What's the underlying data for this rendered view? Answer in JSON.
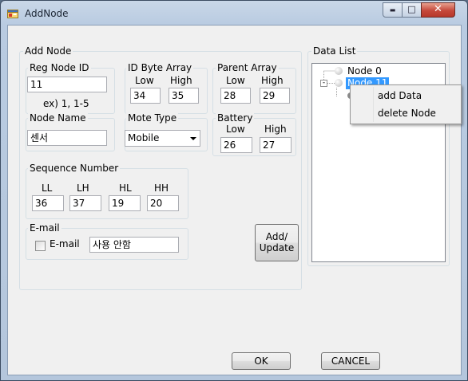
{
  "window": {
    "title": "AddNode"
  },
  "caption_buttons": {
    "minimize": "▬",
    "maximize": "□",
    "close": "✕"
  },
  "add_node": {
    "label": "Add Node",
    "reg_node_id": {
      "label": "Reg Node ID",
      "value": "11",
      "hint": "ex) 1, 1-5"
    },
    "id_byte_array": {
      "label": "ID Byte Array",
      "low_label": "Low",
      "high_label": "High",
      "low": "34",
      "high": "35"
    },
    "parent_array": {
      "label": "Parent Array",
      "low_label": "Low",
      "high_label": "High",
      "low": "28",
      "high": "29"
    },
    "node_name": {
      "label": "Node Name",
      "value": "센서"
    },
    "mote_type": {
      "label": "Mote Type",
      "value": "Mobile"
    },
    "battery": {
      "label": "Battery",
      "low_label": "Low",
      "high_label": "High",
      "low": "26",
      "high": "27"
    },
    "sequence": {
      "label": "Sequence Number",
      "ll_label": "LL",
      "lh_label": "LH",
      "hl_label": "HL",
      "hh_label": "HH",
      "ll": "36",
      "lh": "37",
      "hl": "19",
      "hh": "20"
    },
    "email": {
      "label": "E-mail",
      "checkbox_label": "E-mail",
      "value": "사용 안함",
      "checked": false
    },
    "add_update": {
      "line1": "Add/",
      "line2": "Update"
    }
  },
  "data_list": {
    "label": "Data List",
    "nodes": [
      "Node 0",
      "Node 11"
    ],
    "selected_index": 1
  },
  "context_menu": {
    "items": [
      "add Data",
      "delete Node"
    ]
  },
  "footer": {
    "ok": "OK",
    "cancel": "CANCEL"
  },
  "colors": {
    "selection": "#3399ff",
    "group_border": "#d5dfe5",
    "title_gradient_top": "#c9d7e8"
  },
  "icons": [
    "app-form-icon",
    "minimize-icon",
    "maximize-icon",
    "close-icon",
    "tree-node-icon",
    "tree-collapse-icon",
    "checkbox-icon",
    "dropdown-arrow-icon"
  ]
}
